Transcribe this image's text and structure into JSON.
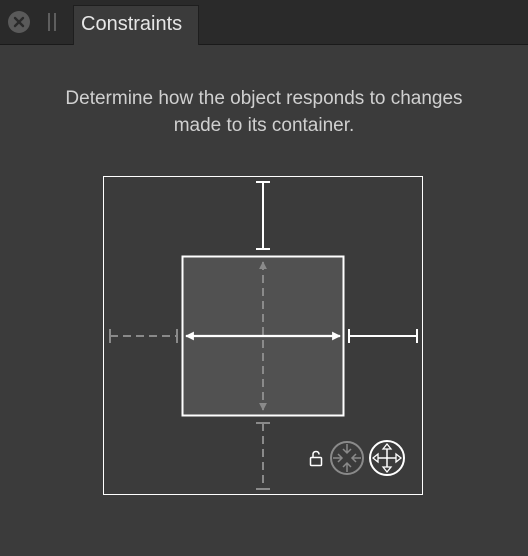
{
  "panel": {
    "tab_label": "Constraints",
    "description": "Determine how the object responds to changes made to its container."
  },
  "constraints": {
    "top": "fixed",
    "left": "flexible",
    "right": "fixed",
    "bottom": "flexible",
    "width": "fixed",
    "height": "flexible"
  },
  "icons": {
    "close": "close-icon",
    "grip": "drag-handle-icon",
    "lock": "lock-icon",
    "scale_mode": "scale-toward-center-icon",
    "move_mode": "move-arrows-icon"
  },
  "colors": {
    "background": "#3b3b3b",
    "tabbar": "#2a2a2a",
    "text": "#d0d0d0",
    "fixed_constraint": "#ffffff",
    "flexible_constraint": "#8a8a8a",
    "object_fill": "#515151"
  }
}
